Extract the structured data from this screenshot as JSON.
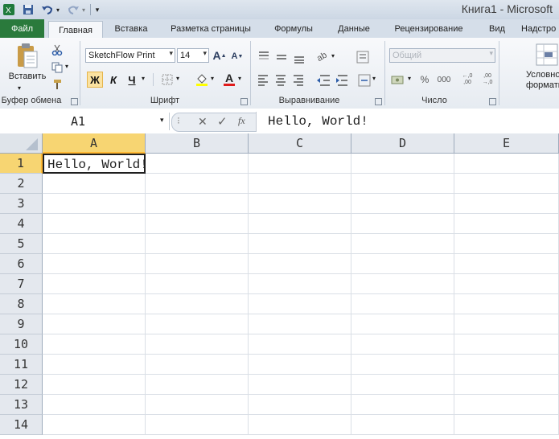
{
  "window": {
    "title": "Книга1 - Microsoft"
  },
  "quick_access": {
    "icons": [
      "excel-icon",
      "save-icon",
      "undo-icon",
      "redo-icon",
      "customize-icon"
    ]
  },
  "tabs": [
    {
      "label": "Файл"
    },
    {
      "label": "Главная"
    },
    {
      "label": "Вставка"
    },
    {
      "label": "Разметка страницы"
    },
    {
      "label": "Формулы"
    },
    {
      "label": "Данные"
    },
    {
      "label": "Рецензирование"
    },
    {
      "label": "Вид"
    },
    {
      "label": "Надстро"
    }
  ],
  "ribbon": {
    "clipboard": {
      "label": "Буфер обмена",
      "paste_label": "Вставить"
    },
    "font": {
      "label": "Шрифт",
      "font_name": "SketchFlow Print",
      "font_size": "14",
      "bold": "Ж",
      "italic": "К",
      "underline": "Ч"
    },
    "alignment": {
      "label": "Выравнивание"
    },
    "number": {
      "label": "Число",
      "format": "Общий",
      "percent": "%",
      "thousands": "000"
    },
    "styles": {
      "label1": "Условно",
      "label2": "форматиров"
    }
  },
  "formula_bar": {
    "name_box": "A1",
    "fx": "fx",
    "content": "Hello, World!"
  },
  "sheet": {
    "columns": [
      "A",
      "B",
      "C",
      "D",
      "E"
    ],
    "rows": [
      "1",
      "2",
      "3",
      "4",
      "5",
      "6",
      "7",
      "8",
      "9",
      "10",
      "11",
      "12",
      "13",
      "14"
    ],
    "cells": {
      "A1": "Hello, World!"
    }
  },
  "colors": {
    "file_tab": "#2a7a3c",
    "selected_header": "#f7d572"
  }
}
